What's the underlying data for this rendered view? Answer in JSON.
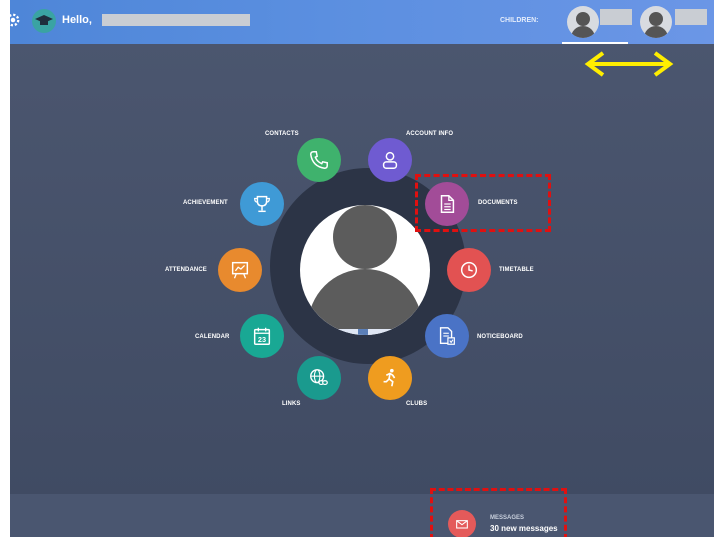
{
  "header": {
    "greeting": "Hello,",
    "children_label": "CHILDREN:"
  },
  "menu": {
    "contacts": "CONTACTS",
    "account_info": "ACCOUNT INFO",
    "achievement": "ACHIEVEMENT",
    "documents": "DOCUMENTS",
    "attendance": "ATTENDANCE",
    "timetable": "TIMETABLE",
    "calendar": "CALENDAR",
    "noticeboard": "NOTICEBOARD",
    "links": "LINKS",
    "clubs": "CLUBS",
    "calendar_day": "23"
  },
  "messages": {
    "title": "MESSAGES",
    "count_text": "30 new messages"
  },
  "colors": {
    "contacts": "#3fb26d",
    "account_info": "#6f5bd1",
    "achievement": "#3f9ad6",
    "documents": "#a24c98",
    "attendance": "#e88a2e",
    "timetable": "#e25252",
    "calendar": "#19a894",
    "noticeboard": "#4a73c6",
    "links": "#1a9a8e",
    "clubs": "#ef9c1f",
    "highlight": "#e01010",
    "arrow": "#ffee00"
  },
  "icons": {
    "contacts": "phone-icon",
    "account_info": "user-icon",
    "achievement": "trophy-icon",
    "documents": "document-icon",
    "attendance": "presentation-chart-icon",
    "timetable": "clock-icon",
    "calendar": "calendar-icon",
    "noticeboard": "notice-icon",
    "links": "globe-link-icon",
    "clubs": "running-icon",
    "messages": "envelope-icon"
  }
}
